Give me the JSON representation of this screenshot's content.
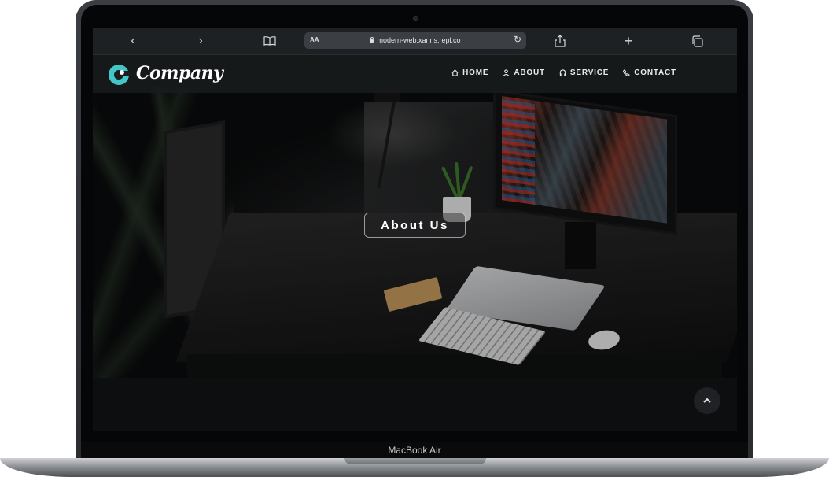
{
  "device": {
    "model_label": "MacBook Air"
  },
  "browser": {
    "back_icon": "chevron-left",
    "forward_icon": "chevron-right",
    "reader_icon": "book",
    "text_size_label": "AA",
    "url": "modern-web.xanns.repl.co",
    "reload_icon": "reload",
    "share_icon": "share",
    "new_tab_icon": "plus",
    "tabs_icon": "tabs"
  },
  "site": {
    "logo_text": "Company",
    "nav": [
      {
        "label": "HOME",
        "icon": "home"
      },
      {
        "label": "ABOUT",
        "icon": "person"
      },
      {
        "label": "SERVICE",
        "icon": "headset"
      },
      {
        "label": "CONTACT",
        "icon": "phone"
      }
    ],
    "hero_button": "About Us",
    "scroll_top_icon": "chevron-up"
  }
}
